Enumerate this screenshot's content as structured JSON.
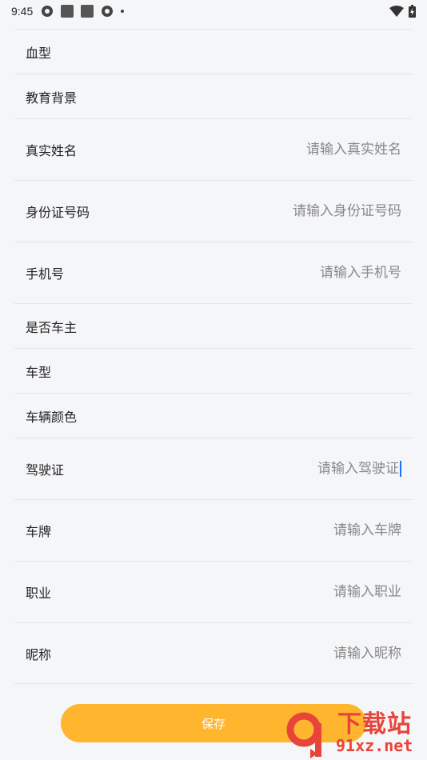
{
  "status_bar": {
    "time": "9:45"
  },
  "form": {
    "rows": [
      {
        "label": "血型",
        "placeholder": ""
      },
      {
        "label": "教育背景",
        "placeholder": ""
      },
      {
        "label": "真实姓名",
        "placeholder": "请输入真实姓名"
      },
      {
        "label": "身份证号码",
        "placeholder": "请输入身份证号码"
      },
      {
        "label": "手机号",
        "placeholder": "请输入手机号"
      },
      {
        "label": "是否车主",
        "placeholder": ""
      },
      {
        "label": "车型",
        "placeholder": ""
      },
      {
        "label": "车辆颜色",
        "placeholder": ""
      },
      {
        "label": "驾驶证",
        "placeholder": "请输入驾驶证"
      },
      {
        "label": "车牌",
        "placeholder": "请输入车牌"
      },
      {
        "label": "职业",
        "placeholder": "请输入职业"
      },
      {
        "label": "昵称",
        "placeholder": "请输入昵称"
      }
    ]
  },
  "save_button": {
    "label": "保存"
  },
  "watermark": {
    "title": "下载站",
    "url": "91xz.net"
  },
  "colors": {
    "accent": "#ffb52e",
    "watermark": "#e8443a",
    "background": "#f5f6f8"
  }
}
